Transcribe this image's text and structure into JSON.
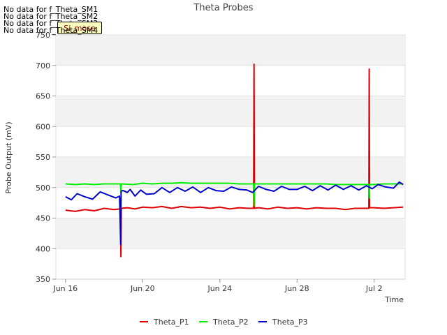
{
  "messages": [
    "No data for f_Theta_SM1",
    "No data for f_Theta_SM2",
    "No data for f_Theta_SM3",
    "No data for f_Theta_SM4"
  ],
  "badge": "Si_mose",
  "chart_data": {
    "type": "line",
    "title": "Theta Probes",
    "xlabel": "Time",
    "ylabel": "Probe Output (mV)",
    "ylim": [
      350,
      750
    ],
    "yticks": [
      350,
      400,
      450,
      500,
      550,
      600,
      650,
      700,
      750
    ],
    "xticks": [
      {
        "day": 0,
        "label": "Jun 16"
      },
      {
        "day": 4,
        "label": "Jun 20"
      },
      {
        "day": 8,
        "label": "Jun 24"
      },
      {
        "day": 12,
        "label": "Jun 28"
      },
      {
        "day": 16,
        "label": "Jul 2"
      }
    ],
    "xlim": [
      -0.5,
      17.6
    ],
    "grid": true,
    "legend_position": "bottom",
    "series": [
      {
        "name": "Theta_P1",
        "color": "#dd0000",
        "x": [
          0,
          0.5,
          1.0,
          1.5,
          2.0,
          2.5,
          2.85,
          2.87,
          2.89,
          3.2,
          3.6,
          4.0,
          4.5,
          5.0,
          5.5,
          6.0,
          6.5,
          7.0,
          7.5,
          8.0,
          8.5,
          9.0,
          9.5,
          9.75,
          9.77,
          9.79,
          10.0,
          10.5,
          11.0,
          11.5,
          12.0,
          12.5,
          13.0,
          13.5,
          14.0,
          14.5,
          15.0,
          15.5,
          15.72,
          15.74,
          15.76,
          16.0,
          16.5,
          17.0,
          17.5
        ],
        "y": [
          463,
          461,
          464,
          462,
          466,
          464,
          465,
          387,
          466,
          467,
          465,
          468,
          467,
          469,
          466,
          469,
          467,
          468,
          466,
          468,
          465,
          467,
          466,
          466,
          702,
          466,
          467,
          465,
          468,
          466,
          467,
          465,
          467,
          466,
          466,
          464,
          466,
          466,
          466,
          694,
          467,
          467,
          466,
          467,
          468
        ]
      },
      {
        "name": "Theta_P2",
        "color": "#00ee00",
        "x": [
          0,
          0.5,
          1.0,
          1.5,
          2.0,
          2.5,
          2.85,
          2.87,
          2.89,
          3.5,
          4.0,
          4.5,
          5.0,
          5.5,
          6.0,
          6.5,
          7.0,
          7.5,
          8.0,
          8.5,
          9.0,
          9.5,
          9.75,
          9.77,
          9.79,
          10.0,
          10.5,
          11.0,
          11.5,
          12.0,
          12.5,
          13.0,
          13.5,
          14.0,
          14.5,
          15.0,
          15.5,
          15.72,
          15.74,
          15.76,
          16.0,
          16.5,
          17.0,
          17.5
        ],
        "y": [
          506,
          505,
          506,
          505,
          506,
          506,
          506,
          492,
          506,
          505,
          507,
          506,
          507,
          507,
          508,
          507,
          507,
          507,
          507,
          507,
          506,
          506,
          506,
          470,
          506,
          506,
          506,
          506,
          506,
          506,
          506,
          506,
          506,
          505,
          505,
          505,
          505,
          505,
          483,
          505,
          505,
          506,
          506,
          506
        ]
      },
      {
        "name": "Theta_P3",
        "color": "#0000cc",
        "x": [
          0,
          0.3,
          0.6,
          1.0,
          1.4,
          1.8,
          2.2,
          2.6,
          2.8,
          2.86,
          2.88,
          2.92,
          3.0,
          3.2,
          3.35,
          3.6,
          3.9,
          4.2,
          4.6,
          5.0,
          5.4,
          5.8,
          6.2,
          6.6,
          7.0,
          7.4,
          7.8,
          8.2,
          8.6,
          9.0,
          9.4,
          9.7,
          10.0,
          10.4,
          10.8,
          11.2,
          11.6,
          12.0,
          12.4,
          12.8,
          13.2,
          13.6,
          14.0,
          14.4,
          14.8,
          15.2,
          15.6,
          15.9,
          16.2,
          16.6,
          17.0,
          17.3,
          17.5
        ],
        "y": [
          485,
          480,
          490,
          485,
          481,
          493,
          488,
          483,
          486,
          407,
          493,
          495,
          495,
          492,
          497,
          486,
          496,
          489,
          490,
          500,
          492,
          500,
          494,
          501,
          492,
          500,
          495,
          494,
          501,
          497,
          496,
          492,
          502,
          497,
          494,
          502,
          497,
          497,
          502,
          495,
          503,
          496,
          504,
          497,
          503,
          496,
          503,
          498,
          505,
          501,
          499,
          509,
          505
        ]
      }
    ]
  }
}
